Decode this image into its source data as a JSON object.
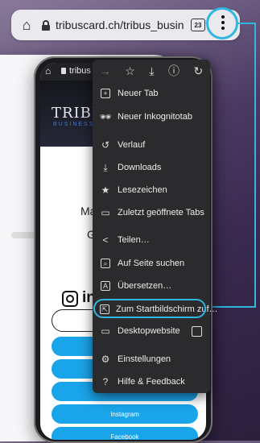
{
  "address_bar": {
    "url": "tribuscard.ch/tribus_busine",
    "tab_count": "23"
  },
  "phone": {
    "url": "tribus",
    "logo": "TRIBUS",
    "logo_sub": "BUSINESS",
    "name_line1": "Ma",
    "name_line2": "G",
    "instagram_label": "Instagram",
    "facebook_label": "Facebook"
  },
  "menu": {
    "top_icons": [
      "arrow-forward-icon",
      "star-icon",
      "download-icon",
      "info-icon",
      "refresh-icon"
    ],
    "items": [
      {
        "label": "Neuer Tab",
        "icon": "plus-box-icon"
      },
      {
        "label": "Neuer Inkognitotab",
        "icon": "incognito-icon"
      },
      {
        "label": "Verlauf",
        "icon": "history-icon"
      },
      {
        "label": "Downloads",
        "icon": "downloads-icon"
      },
      {
        "label": "Lesezeichen",
        "icon": "star-icon"
      },
      {
        "label": "Zuletzt geöffnete Tabs",
        "icon": "recent-tabs-icon"
      },
      {
        "label": "Teilen…",
        "icon": "share-icon"
      },
      {
        "label": "Auf Seite suchen",
        "icon": "find-in-page-icon"
      },
      {
        "label": "Übersetzen…",
        "icon": "translate-icon"
      },
      {
        "label": "Zum Startbildschirm zuf…",
        "icon": "add-to-home-icon"
      },
      {
        "label": "Desktopwebsite",
        "icon": "desktop-icon"
      },
      {
        "label": "Einstellungen",
        "icon": "gear-icon"
      },
      {
        "label": "Hilfe & Feedback",
        "icon": "help-icon"
      }
    ]
  },
  "colors": {
    "highlight": "#31b6e0",
    "menu_bg": "#2b2b2e",
    "button_blue": "#1aa4ea"
  }
}
